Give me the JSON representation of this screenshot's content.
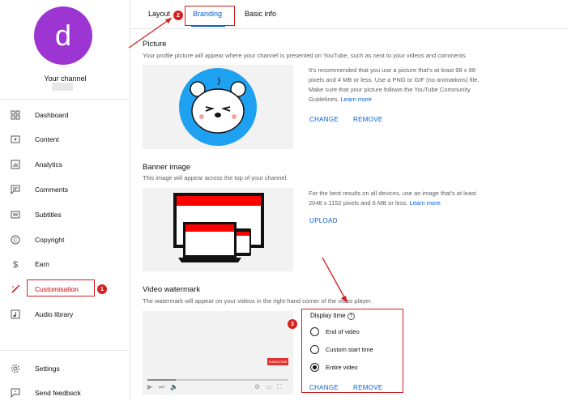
{
  "sidebar": {
    "avatar_letter": "d",
    "channel_label": "Your channel",
    "items": [
      {
        "label": "Dashboard",
        "icon": "dashboard-icon"
      },
      {
        "label": "Content",
        "icon": "content-icon"
      },
      {
        "label": "Analytics",
        "icon": "analytics-icon"
      },
      {
        "label": "Comments",
        "icon": "comments-icon"
      },
      {
        "label": "Subtitles",
        "icon": "subtitles-icon"
      },
      {
        "label": "Copyright",
        "icon": "copyright-icon"
      },
      {
        "label": "Earn",
        "icon": "earn-icon"
      },
      {
        "label": "Customisation",
        "icon": "customisation-icon"
      },
      {
        "label": "Audio library",
        "icon": "audio-library-icon"
      }
    ],
    "bottom_items": [
      {
        "label": "Settings",
        "icon": "gear-icon"
      },
      {
        "label": "Send feedback",
        "icon": "feedback-icon"
      }
    ]
  },
  "tabs": [
    "Layout",
    "Branding",
    "Basic info"
  ],
  "step_badges": [
    "1",
    "2",
    "3"
  ],
  "picture": {
    "title": "Picture",
    "description": "Your profile picture will appear where your channel is presented on YouTube, such as next to your videos and comments",
    "info": "It's recommended that you use a picture that's at least 98 x 98 pixels and 4 MB or less. Use a PNG or GIF (no animations) file. Make sure that your picture follows the YouTube Community Guidelines.",
    "learn_more": "Learn more",
    "change": "CHANGE",
    "remove": "REMOVE"
  },
  "banner": {
    "title": "Banner image",
    "description": "This image will appear across the top of your channel.",
    "info": "For the best results on all devices, use an image that's at least 2048 x 1152 pixels and 6 MB or less.",
    "learn_more": "Learn more",
    "upload": "UPLOAD"
  },
  "watermark": {
    "title": "Video watermark",
    "description": "The watermark will appear on your videos in the right-hand corner of the video player.",
    "subscribe_badge": "SUBSCRIBE",
    "display_time_label": "Display time",
    "options": [
      "End of video",
      "Custom start time",
      "Entire video"
    ],
    "selected_option": "Entire video",
    "change": "CHANGE",
    "remove": "REMOVE",
    "progress": 0.2
  },
  "colors": {
    "avatar": "#9c35d1",
    "accent_blue": "#065fd4",
    "annotation_red": "#d41f1f",
    "banner_red": "#ff0000"
  }
}
